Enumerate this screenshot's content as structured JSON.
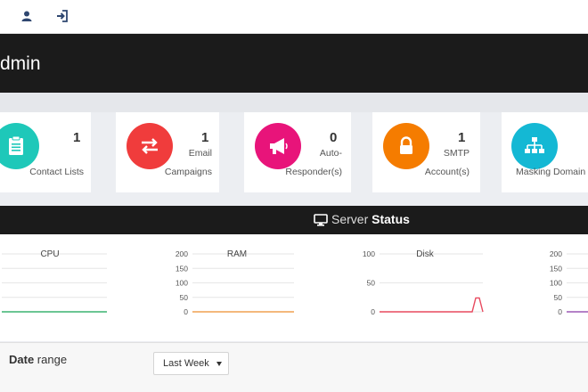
{
  "header": {
    "title": "dmin"
  },
  "topbar": {
    "icons": [
      "user-icon",
      "sign-in-icon"
    ]
  },
  "stats": [
    {
      "id": "contact-lists",
      "value": "1",
      "label_line1": "",
      "label_line2": "Contact Lists",
      "color": "#1ec8b9",
      "icon": "clipboard-icon"
    },
    {
      "id": "email-campaigns",
      "value": "1",
      "label_line1": "Email",
      "label_line2": "Campaigns",
      "color": "#f03c3c",
      "icon": "exchange-icon"
    },
    {
      "id": "auto-responders",
      "value": "0",
      "label_line1": "Auto-",
      "label_line2": "Responder(s)",
      "color": "#e8147a",
      "icon": "bullhorn-icon"
    },
    {
      "id": "smtp-accounts",
      "value": "1",
      "label_line1": "SMTP",
      "label_line2": "Account(s)",
      "color": "#f57c00",
      "icon": "lock-icon"
    },
    {
      "id": "masking-domains",
      "value": "",
      "label_line1": "",
      "label_line2": "Masking Domain",
      "color": "#14b8d4",
      "icon": "sitemap-icon"
    }
  ],
  "server_status": {
    "prefix": "Server",
    "bold": "Status",
    "icon": "desktop-icon"
  },
  "chart_data": [
    {
      "type": "line",
      "title": "CPU",
      "y_ticks": [],
      "ylim": [
        0,
        200
      ],
      "series": [
        {
          "values": [
            0,
            0,
            0,
            0,
            0,
            0,
            0,
            0,
            0,
            0
          ]
        }
      ],
      "color": "#3cb371"
    },
    {
      "type": "line",
      "title": "RAM",
      "y_ticks": [
        "200",
        "150",
        "100",
        "50",
        "0"
      ],
      "ylim": [
        0,
        200
      ],
      "series": [
        {
          "values": [
            0,
            0,
            0,
            0,
            0,
            0,
            0,
            0,
            0,
            0
          ]
        }
      ],
      "color": "#f0a050"
    },
    {
      "type": "line",
      "title": "Disk",
      "y_ticks": [
        "100",
        "50",
        "0"
      ],
      "ylim": [
        0,
        100
      ],
      "series": [
        {
          "values": [
            0,
            0,
            0,
            0,
            0,
            0,
            0,
            0,
            0,
            0,
            0,
            0,
            0,
            0,
            0,
            0,
            0,
            0,
            0,
            0,
            0,
            0,
            0,
            0,
            0,
            0,
            0,
            24,
            24,
            0
          ]
        }
      ],
      "color": "#e84a5f"
    },
    {
      "type": "line",
      "title": "",
      "y_ticks": [
        "200",
        "150",
        "100",
        "50",
        "0"
      ],
      "ylim": [
        0,
        200
      ],
      "series": [
        {
          "values": [
            0,
            0,
            0
          ]
        }
      ],
      "color": "#9b59b6"
    }
  ],
  "date_range": {
    "label_bold": "Date",
    "label_rest": " range",
    "selected": "Last Week"
  }
}
